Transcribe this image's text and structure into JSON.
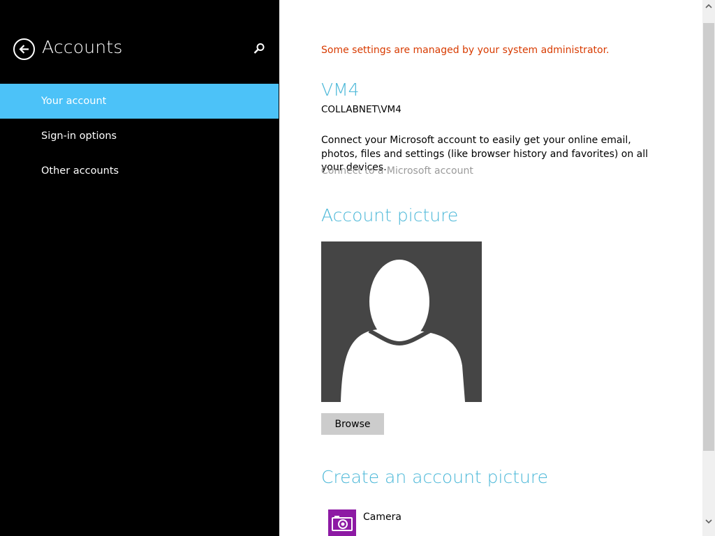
{
  "left_pane": {
    "title": "Accounts",
    "back_icon": "back-arrow-circle-icon",
    "search_icon": "search-icon",
    "nav_items": [
      {
        "label": "Your account",
        "active": true
      },
      {
        "label": "Sign-in options",
        "active": false
      },
      {
        "label": "Other accounts",
        "active": false
      }
    ]
  },
  "main": {
    "admin_notice": "Some settings are managed by your system administrator.",
    "account_name": "VM4",
    "account_domain": "COLLABNET\\VM4",
    "description": "Connect your Microsoft account to easily get your online email, photos, files and settings (like browser history and favorites) on all your devices.",
    "connect_link": "Connect to a Microsoft account",
    "account_picture_heading": "Account picture",
    "browse_label": "Browse",
    "create_picture_heading": "Create an account picture",
    "apps": [
      {
        "label": "Camera",
        "icon": "camera-icon",
        "tile_color": "#8d1aa4"
      }
    ]
  },
  "colors": {
    "accent": "#4cc2f8",
    "heading": "#4cb8d8",
    "warning": "#d83b01",
    "link_disabled": "#9a9a9a"
  }
}
